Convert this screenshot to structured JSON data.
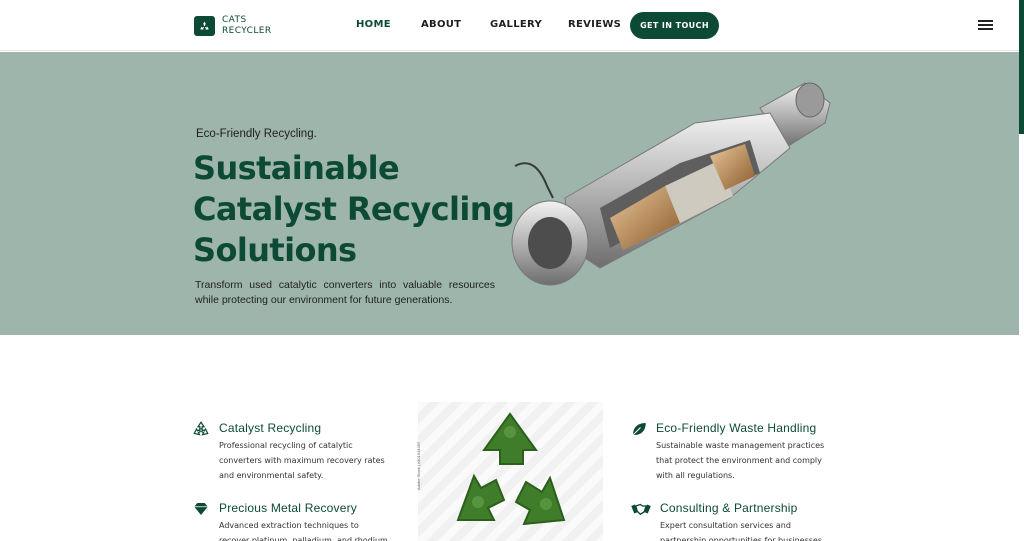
{
  "nav": {
    "logo_line1": "CATS",
    "logo_line2": "RECYCLER",
    "links": [
      "HOME",
      "ABOUT",
      "GALLERY",
      "REVIEWS"
    ],
    "cta": "GET IN TOUCH",
    "active_index": 0
  },
  "hero": {
    "eyebrow": "Eco-Friendly Recycling.",
    "headline_lines": [
      "Sustainable",
      "Catalyst Recycling",
      "Solutions"
    ],
    "subtext": "Transform used catalytic converters into valuable resources while protecting our environment for future generations.",
    "image_icon": "catalytic-converter-image"
  },
  "features": {
    "left": [
      {
        "icon": "recycle-icon",
        "title": "Catalyst Recycling",
        "desc": "Professional recycling of catalytic converters with maximum recovery rates and environmental safety."
      },
      {
        "icon": "diamond-icon",
        "title": "Precious Metal Recovery",
        "desc": "Advanced extraction techniques to recover platinum, palladium, and rhodium from"
      }
    ],
    "right": [
      {
        "icon": "leaf-icon",
        "title": "Eco-Friendly Waste Handling",
        "desc": "Sustainable waste management practices that protect the environment and comply with all regulations."
      },
      {
        "icon": "handshake-icon",
        "title": "Consulting & Partnership",
        "desc": "Expert consultation services and partnership opportunities for businesses"
      }
    ],
    "center_image_icon": "green-recycle-symbol-image",
    "center_caption": "Adobe Stock | #301944497"
  },
  "colors": {
    "brand": "#0d4a35",
    "hero_bg": "#9db5aa",
    "white": "#ffffff"
  }
}
